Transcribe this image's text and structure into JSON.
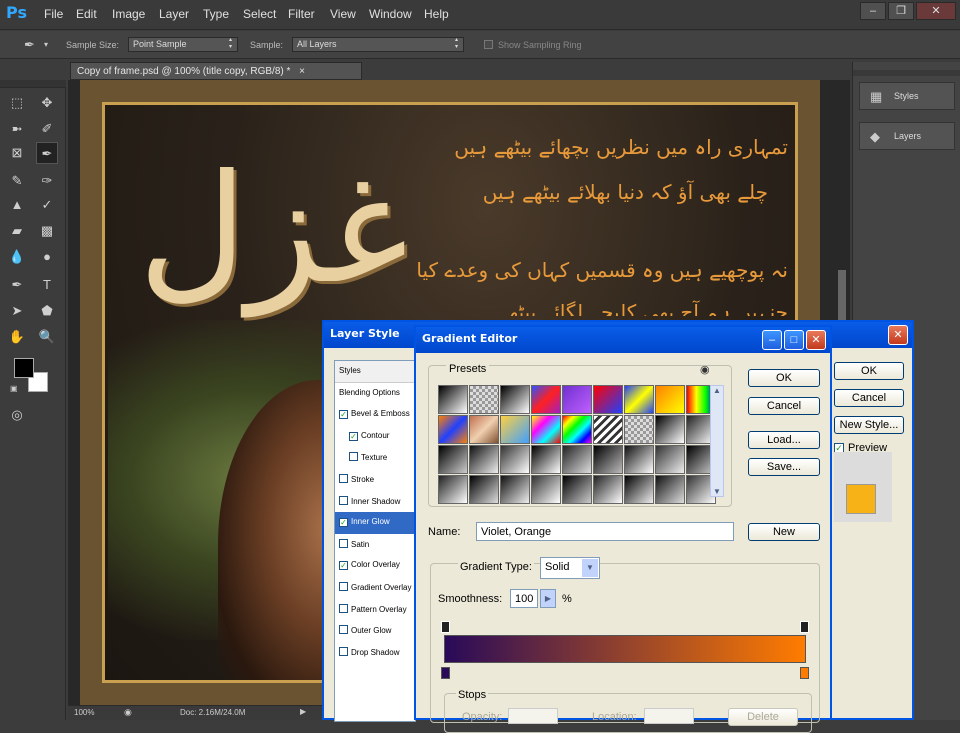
{
  "menubar": {
    "logo": "Ps",
    "items": [
      "File",
      "Edit",
      "Image",
      "Layer",
      "Type",
      "Select",
      "Filter",
      "View",
      "Window",
      "Help"
    ]
  },
  "options_bar": {
    "sample_size_label": "Sample Size:",
    "sample_size_value": "Point Sample",
    "sample_label": "Sample:",
    "sample_value": "All Layers",
    "show_ring_label": "Show Sampling Ring"
  },
  "document": {
    "tab_title": "Copy of frame.psd @ 100% (title copy, RGB/8) *",
    "artwork_title": "غزل",
    "poem_lines": [
      "تمہاری راہ میں نظریں بچھائے بیٹھے ہیں",
      "چلے بھی آؤ کہ دنیا بھلائے بیٹھے ہیں",
      "نہ پوچھیے ہیں وہ قسمیں کہاں کی وعدے کیا",
      "جنہیں ہم آج بھی کلیجے لگائے بیٹھے ہیں"
    ],
    "zoom": "100%",
    "doc_size": "Doc: 2.16M/24.0M"
  },
  "right_panel": {
    "styles_label": "Styles",
    "layers_label": "Layers"
  },
  "layer_style": {
    "title": "Layer Style",
    "header": "Styles",
    "items": [
      {
        "label": "Blending Options",
        "checkbox": false
      },
      {
        "label": "Bevel & Emboss",
        "checkbox": true,
        "checked": true
      },
      {
        "label": "Contour",
        "checkbox": true,
        "checked": true
      },
      {
        "label": "Texture",
        "checkbox": true,
        "checked": false
      },
      {
        "label": "Stroke",
        "checkbox": true,
        "checked": false
      },
      {
        "label": "Inner Shadow",
        "checkbox": true,
        "checked": false
      },
      {
        "label": "Inner Glow",
        "checkbox": true,
        "checked": true,
        "active": true
      },
      {
        "label": "Satin",
        "checkbox": true,
        "checked": false
      },
      {
        "label": "Color Overlay",
        "checkbox": true,
        "checked": true
      },
      {
        "label": "Gradient Overlay",
        "checkbox": true,
        "checked": false
      },
      {
        "label": "Pattern Overlay",
        "checkbox": true,
        "checked": false
      },
      {
        "label": "Outer Glow",
        "checkbox": true,
        "checked": false
      },
      {
        "label": "Drop Shadow",
        "checkbox": true,
        "checked": false
      }
    ],
    "ok": "OK",
    "cancel": "Cancel",
    "new_style": "New Style...",
    "preview_label": "Preview",
    "swatch_color": "#f7b218"
  },
  "gradient_editor": {
    "title": "Gradient Editor",
    "presets_label": "Presets",
    "ok": "OK",
    "cancel": "Cancel",
    "load": "Load...",
    "save": "Save...",
    "name_label": "Name:",
    "name_value": "Violet, Orange",
    "new_button": "New",
    "gradient_type_label": "Gradient Type:",
    "gradient_type_value": "Solid",
    "smoothness_label": "Smoothness:",
    "smoothness_value": "100",
    "smoothness_unit": "%",
    "stops_label": "Stops",
    "opacity_label": "Opacity:",
    "location_label": "Location:",
    "delete_label": "Delete",
    "gradient_start": "#290a59",
    "gradient_end": "#ff7c00"
  }
}
